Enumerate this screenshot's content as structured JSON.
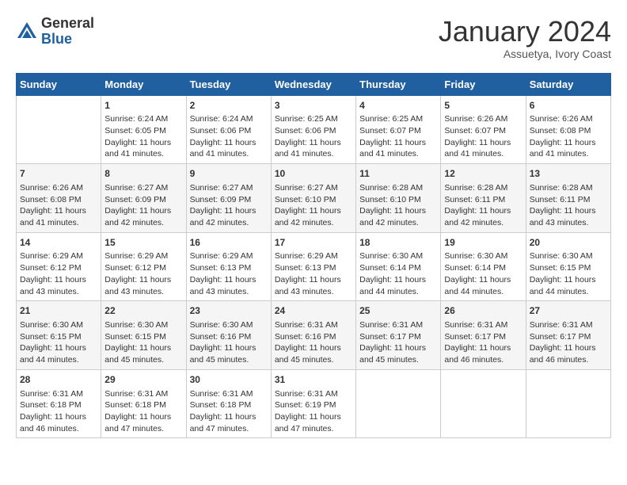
{
  "header": {
    "logo_general": "General",
    "logo_blue": "Blue",
    "month_title": "January 2024",
    "location": "Assuetya, Ivory Coast"
  },
  "weekdays": [
    "Sunday",
    "Monday",
    "Tuesday",
    "Wednesday",
    "Thursday",
    "Friday",
    "Saturday"
  ],
  "weeks": [
    [
      {
        "day": "",
        "sunrise": "",
        "sunset": "",
        "daylight": ""
      },
      {
        "day": "1",
        "sunrise": "Sunrise: 6:24 AM",
        "sunset": "Sunset: 6:05 PM",
        "daylight": "Daylight: 11 hours and 41 minutes."
      },
      {
        "day": "2",
        "sunrise": "Sunrise: 6:24 AM",
        "sunset": "Sunset: 6:06 PM",
        "daylight": "Daylight: 11 hours and 41 minutes."
      },
      {
        "day": "3",
        "sunrise": "Sunrise: 6:25 AM",
        "sunset": "Sunset: 6:06 PM",
        "daylight": "Daylight: 11 hours and 41 minutes."
      },
      {
        "day": "4",
        "sunrise": "Sunrise: 6:25 AM",
        "sunset": "Sunset: 6:07 PM",
        "daylight": "Daylight: 11 hours and 41 minutes."
      },
      {
        "day": "5",
        "sunrise": "Sunrise: 6:26 AM",
        "sunset": "Sunset: 6:07 PM",
        "daylight": "Daylight: 11 hours and 41 minutes."
      },
      {
        "day": "6",
        "sunrise": "Sunrise: 6:26 AM",
        "sunset": "Sunset: 6:08 PM",
        "daylight": "Daylight: 11 hours and 41 minutes."
      }
    ],
    [
      {
        "day": "7",
        "sunrise": "Sunrise: 6:26 AM",
        "sunset": "Sunset: 6:08 PM",
        "daylight": "Daylight: 11 hours and 41 minutes."
      },
      {
        "day": "8",
        "sunrise": "Sunrise: 6:27 AM",
        "sunset": "Sunset: 6:09 PM",
        "daylight": "Daylight: 11 hours and 42 minutes."
      },
      {
        "day": "9",
        "sunrise": "Sunrise: 6:27 AM",
        "sunset": "Sunset: 6:09 PM",
        "daylight": "Daylight: 11 hours and 42 minutes."
      },
      {
        "day": "10",
        "sunrise": "Sunrise: 6:27 AM",
        "sunset": "Sunset: 6:10 PM",
        "daylight": "Daylight: 11 hours and 42 minutes."
      },
      {
        "day": "11",
        "sunrise": "Sunrise: 6:28 AM",
        "sunset": "Sunset: 6:10 PM",
        "daylight": "Daylight: 11 hours and 42 minutes."
      },
      {
        "day": "12",
        "sunrise": "Sunrise: 6:28 AM",
        "sunset": "Sunset: 6:11 PM",
        "daylight": "Daylight: 11 hours and 42 minutes."
      },
      {
        "day": "13",
        "sunrise": "Sunrise: 6:28 AM",
        "sunset": "Sunset: 6:11 PM",
        "daylight": "Daylight: 11 hours and 43 minutes."
      }
    ],
    [
      {
        "day": "14",
        "sunrise": "Sunrise: 6:29 AM",
        "sunset": "Sunset: 6:12 PM",
        "daylight": "Daylight: 11 hours and 43 minutes."
      },
      {
        "day": "15",
        "sunrise": "Sunrise: 6:29 AM",
        "sunset": "Sunset: 6:12 PM",
        "daylight": "Daylight: 11 hours and 43 minutes."
      },
      {
        "day": "16",
        "sunrise": "Sunrise: 6:29 AM",
        "sunset": "Sunset: 6:13 PM",
        "daylight": "Daylight: 11 hours and 43 minutes."
      },
      {
        "day": "17",
        "sunrise": "Sunrise: 6:29 AM",
        "sunset": "Sunset: 6:13 PM",
        "daylight": "Daylight: 11 hours and 43 minutes."
      },
      {
        "day": "18",
        "sunrise": "Sunrise: 6:30 AM",
        "sunset": "Sunset: 6:14 PM",
        "daylight": "Daylight: 11 hours and 44 minutes."
      },
      {
        "day": "19",
        "sunrise": "Sunrise: 6:30 AM",
        "sunset": "Sunset: 6:14 PM",
        "daylight": "Daylight: 11 hours and 44 minutes."
      },
      {
        "day": "20",
        "sunrise": "Sunrise: 6:30 AM",
        "sunset": "Sunset: 6:15 PM",
        "daylight": "Daylight: 11 hours and 44 minutes."
      }
    ],
    [
      {
        "day": "21",
        "sunrise": "Sunrise: 6:30 AM",
        "sunset": "Sunset: 6:15 PM",
        "daylight": "Daylight: 11 hours and 44 minutes."
      },
      {
        "day": "22",
        "sunrise": "Sunrise: 6:30 AM",
        "sunset": "Sunset: 6:15 PM",
        "daylight": "Daylight: 11 hours and 45 minutes."
      },
      {
        "day": "23",
        "sunrise": "Sunrise: 6:30 AM",
        "sunset": "Sunset: 6:16 PM",
        "daylight": "Daylight: 11 hours and 45 minutes."
      },
      {
        "day": "24",
        "sunrise": "Sunrise: 6:31 AM",
        "sunset": "Sunset: 6:16 PM",
        "daylight": "Daylight: 11 hours and 45 minutes."
      },
      {
        "day": "25",
        "sunrise": "Sunrise: 6:31 AM",
        "sunset": "Sunset: 6:17 PM",
        "daylight": "Daylight: 11 hours and 45 minutes."
      },
      {
        "day": "26",
        "sunrise": "Sunrise: 6:31 AM",
        "sunset": "Sunset: 6:17 PM",
        "daylight": "Daylight: 11 hours and 46 minutes."
      },
      {
        "day": "27",
        "sunrise": "Sunrise: 6:31 AM",
        "sunset": "Sunset: 6:17 PM",
        "daylight": "Daylight: 11 hours and 46 minutes."
      }
    ],
    [
      {
        "day": "28",
        "sunrise": "Sunrise: 6:31 AM",
        "sunset": "Sunset: 6:18 PM",
        "daylight": "Daylight: 11 hours and 46 minutes."
      },
      {
        "day": "29",
        "sunrise": "Sunrise: 6:31 AM",
        "sunset": "Sunset: 6:18 PM",
        "daylight": "Daylight: 11 hours and 47 minutes."
      },
      {
        "day": "30",
        "sunrise": "Sunrise: 6:31 AM",
        "sunset": "Sunset: 6:18 PM",
        "daylight": "Daylight: 11 hours and 47 minutes."
      },
      {
        "day": "31",
        "sunrise": "Sunrise: 6:31 AM",
        "sunset": "Sunset: 6:19 PM",
        "daylight": "Daylight: 11 hours and 47 minutes."
      },
      {
        "day": "",
        "sunrise": "",
        "sunset": "",
        "daylight": ""
      },
      {
        "day": "",
        "sunrise": "",
        "sunset": "",
        "daylight": ""
      },
      {
        "day": "",
        "sunrise": "",
        "sunset": "",
        "daylight": ""
      }
    ]
  ]
}
